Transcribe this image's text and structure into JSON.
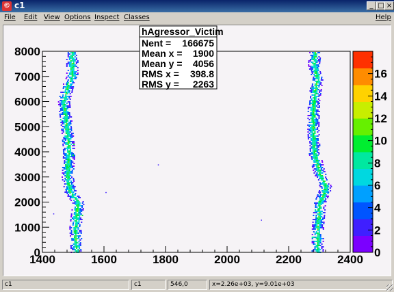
{
  "window": {
    "title": "c1",
    "app_icon_glyph": "©",
    "buttons": {
      "minimize": "_",
      "maximize": "□",
      "close": "×"
    }
  },
  "menu": {
    "items": [
      "File",
      "Edit",
      "View",
      "Options",
      "Inspect",
      "Classes"
    ],
    "help": "Help"
  },
  "chart_data": {
    "type": "heatmap",
    "title": "",
    "xlim": [
      1400,
      2400
    ],
    "ylim": [
      0,
      8000
    ],
    "x_ticks": [
      1400,
      1600,
      1800,
      2000,
      2200,
      2400
    ],
    "y_ticks": [
      0,
      1000,
      2000,
      3000,
      4000,
      5000,
      6000,
      7000,
      8000
    ],
    "z_ticks": [
      0,
      2,
      4,
      6,
      8,
      10,
      12,
      14,
      16
    ],
    "zlim": [
      0,
      18
    ],
    "palette": [
      "#7b00ff",
      "#3f1fff",
      "#0055ff",
      "#00a0ff",
      "#00d8e0",
      "#00e8a0",
      "#00ee30",
      "#66f000",
      "#c8ee00",
      "#ffd200",
      "#ff8c00",
      "#ff3000"
    ],
    "band_left": [
      {
        "y": 0,
        "x": 1510
      },
      {
        "y": 1000,
        "x": 1505
      },
      {
        "y": 2000,
        "x": 1515
      },
      {
        "y": 2400,
        "x": 1490
      },
      {
        "y": 3000,
        "x": 1480
      },
      {
        "y": 4000,
        "x": 1485
      },
      {
        "y": 5000,
        "x": 1478
      },
      {
        "y": 6000,
        "x": 1468
      },
      {
        "y": 6600,
        "x": 1480
      },
      {
        "y": 7000,
        "x": 1495
      },
      {
        "y": 8000,
        "x": 1495
      }
    ],
    "band_right": [
      {
        "y": 0,
        "x": 2292
      },
      {
        "y": 1000,
        "x": 2293
      },
      {
        "y": 2000,
        "x": 2300
      },
      {
        "y": 2600,
        "x": 2320
      },
      {
        "y": 3200,
        "x": 2298
      },
      {
        "y": 4000,
        "x": 2282
      },
      {
        "y": 5000,
        "x": 2278
      },
      {
        "y": 6000,
        "x": 2280
      },
      {
        "y": 7000,
        "x": 2292
      },
      {
        "y": 7500,
        "x": 2280
      },
      {
        "y": 8000,
        "x": 2285
      }
    ],
    "stats": {
      "name": "hAgressor_Victim",
      "rows": [
        {
          "label": "Nent",
          "value": "166675"
        },
        {
          "label": "Mean x",
          "value": "1900"
        },
        {
          "label": "Mean y",
          "value": "4056"
        },
        {
          "label": "RMS x",
          "value": "398.8"
        },
        {
          "label": "RMS y",
          "value": "2263"
        }
      ]
    }
  },
  "status": {
    "fields": [
      "c1",
      "c1",
      "546,0",
      "x=2.26e+03, y=9.01e+03"
    ]
  }
}
